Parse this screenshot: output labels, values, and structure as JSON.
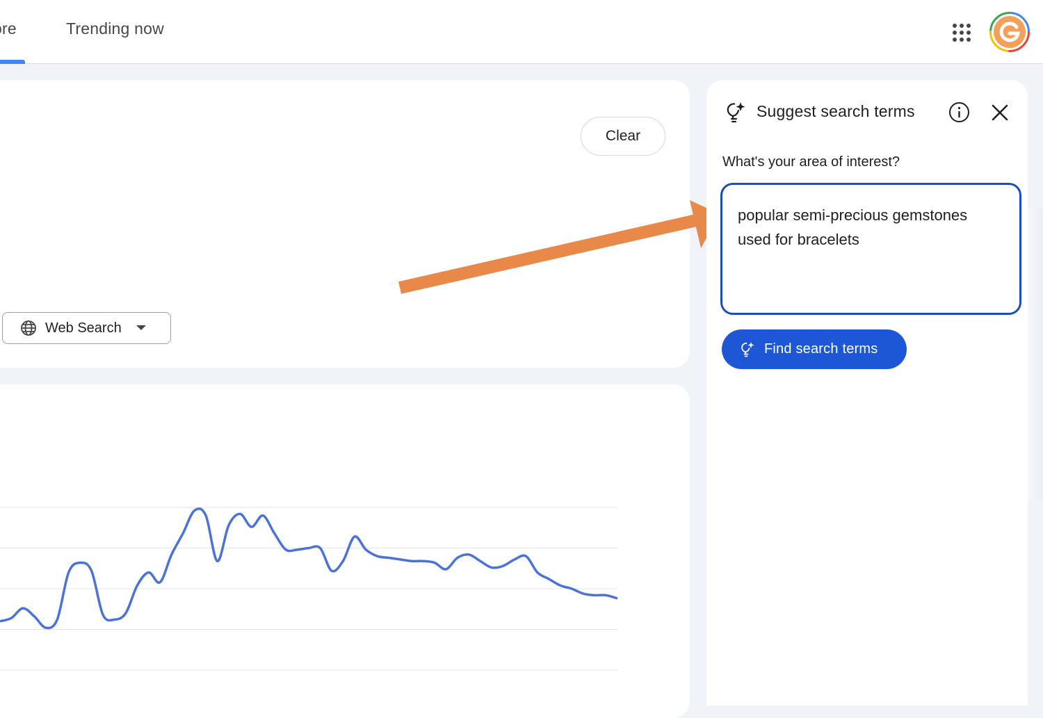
{
  "nav": {
    "tabs": [
      {
        "label": "ore"
      },
      {
        "label": "Trending now"
      }
    ],
    "apps_icon": "apps-grid-icon",
    "avatar_icon": "google-account-avatar-icon"
  },
  "query_card": {
    "clear_label": "Clear",
    "property_select": {
      "label": "Web Search",
      "icon": "globe-icon"
    }
  },
  "chart_data": {
    "type": "line",
    "series": [
      {
        "values": [
          30,
          32,
          38,
          33,
          26,
          31,
          60,
          66,
          61,
          34,
          31,
          35,
          52,
          60,
          54,
          71,
          84,
          98,
          95,
          67,
          89,
          96,
          88,
          95,
          84,
          74,
          74,
          75,
          75,
          61,
          67,
          82,
          74,
          70,
          69,
          68,
          67,
          67,
          66,
          62,
          69,
          71,
          67,
          63,
          64,
          68,
          70,
          60,
          56,
          52,
          50,
          47,
          46,
          46,
          44
        ]
      }
    ],
    "grid": true,
    "accent_color": "#4a72d8"
  },
  "annotation": {
    "arrow_color": "#e8894a"
  },
  "suggest_panel": {
    "title": "Suggest search terms",
    "title_icon": "sparkle-lightbulb-icon",
    "info_icon": "info-icon",
    "close_icon": "close-icon",
    "question": "What's your area of interest?",
    "interest_value": "popular semi-precious gemstones used for bracelets",
    "find_button_label": "Find search terms",
    "find_button_icon": "sparkle-lightbulb-icon",
    "accent_color": "#1e57d6"
  }
}
